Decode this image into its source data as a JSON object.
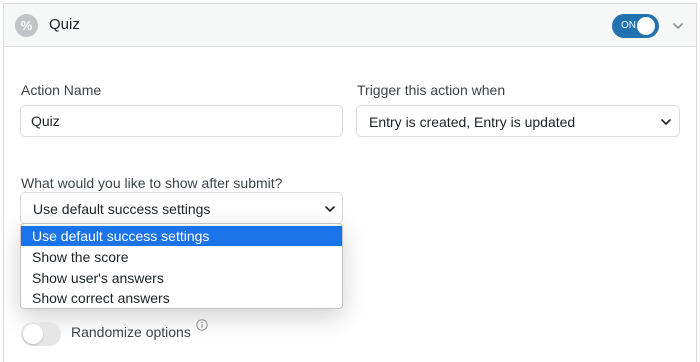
{
  "header": {
    "title": "Quiz",
    "icon": "percent-icon",
    "icon_glyph": "%",
    "enabled_label": "ON",
    "accent_color": "#2271b1"
  },
  "form": {
    "action_name_label": "Action Name",
    "action_name_value": "Quiz",
    "trigger_label": "Trigger this action when",
    "trigger_value": "Entry is created, Entry is updated",
    "show_after_label": "What would you like to show after submit?",
    "show_after_value": "Use default success settings",
    "show_after_options": [
      "Use default success settings",
      "Show the score",
      "Show user's answers",
      "Show correct answers"
    ],
    "show_after_selected_index": 0,
    "randomize_label": "Randomize options",
    "randomize_enabled": false
  },
  "colors": {
    "selected_option": "#1a73e8",
    "toggle_off": "#e6e6e6"
  }
}
